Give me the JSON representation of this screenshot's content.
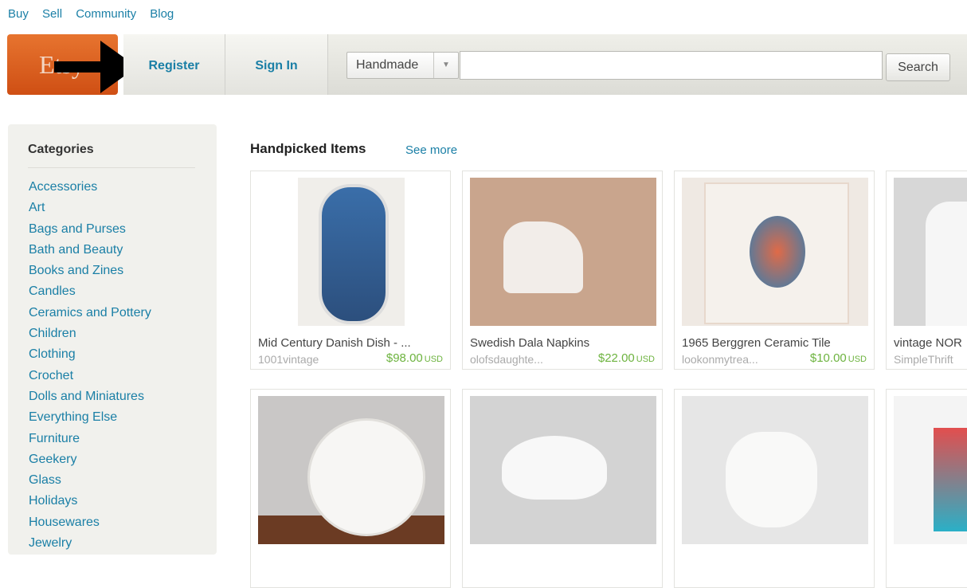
{
  "topnav": [
    "Buy",
    "Sell",
    "Community",
    "Blog"
  ],
  "header": {
    "logo": "Etsy",
    "register": "Register",
    "sign_in": "Sign In",
    "search_category": "Handmade",
    "search_query": "",
    "search_button": "Search"
  },
  "sidebar": {
    "title": "Categories",
    "categories": [
      "Accessories",
      "Art",
      "Bags and Purses",
      "Bath and Beauty",
      "Books and Zines",
      "Candles",
      "Ceramics and Pottery",
      "Children",
      "Clothing",
      "Crochet",
      "Dolls and Miniatures",
      "Everything Else",
      "Furniture",
      "Geekery",
      "Glass",
      "Holidays",
      "Housewares",
      "Jewelry"
    ]
  },
  "main": {
    "section_title": "Handpicked Items",
    "see_more": "See more",
    "items": [
      {
        "title": "Mid Century Danish Dish - ...",
        "shop": "1001vintage",
        "price": "$98.00",
        "currency": "USD"
      },
      {
        "title": "Swedish Dala Napkins",
        "shop": "olofsdaughte...",
        "price": "$22.00",
        "currency": "USD"
      },
      {
        "title": "1965 Berggren Ceramic Tile",
        "shop": "lookonmytrea...",
        "price": "$10.00",
        "currency": "USD"
      },
      {
        "title": "vintage NOR",
        "shop": "SimpleThrift",
        "price": "",
        "currency": ""
      }
    ]
  },
  "colors": {
    "link": "#1a7fa6",
    "price": "#6db33f",
    "logo": "#e06a2b"
  }
}
